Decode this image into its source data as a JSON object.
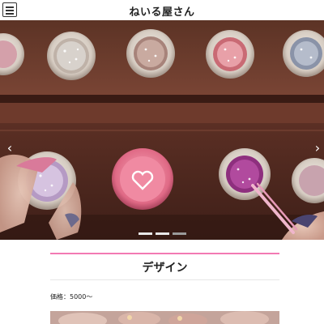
{
  "header": {
    "title": "ねいる屋さん",
    "menu_icon": "hamburger-menu-icon"
  },
  "slider": {
    "image_description": "",
    "prev_icon": "chevron-left-icon",
    "next_icon": "chevron-right-icon",
    "prev_glyph": "‹",
    "next_glyph": "›",
    "slide_count": 3,
    "active_slide": 3
  },
  "section": {
    "title": "デザイン",
    "accent_color": "#f27ab3",
    "price_text": "価格：5000〜"
  }
}
